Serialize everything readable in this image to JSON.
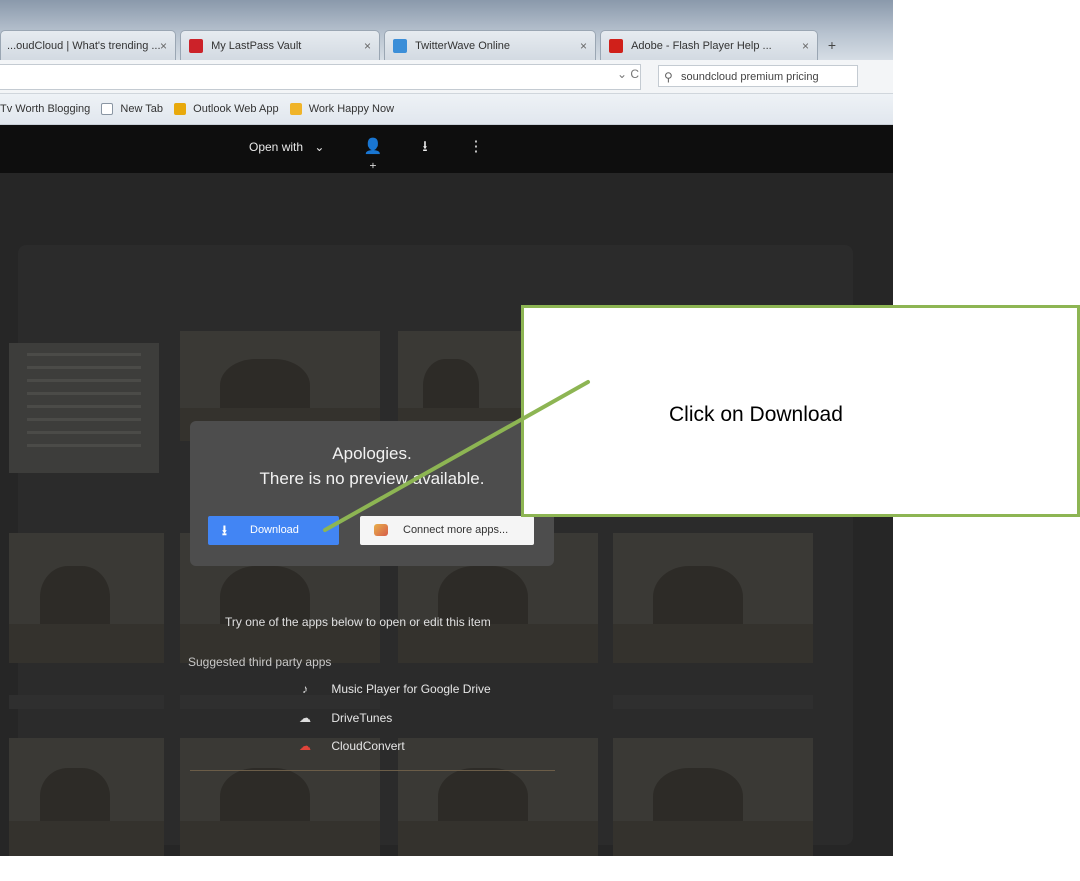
{
  "browser": {
    "tabs": [
      {
        "label": "...oudCloud | What's trending ...",
        "icon_color": "#ff7700"
      },
      {
        "label": "My LastPass Vault",
        "icon_color": "#cc2229"
      },
      {
        "label": "TwitterWave Online",
        "icon_color": "#3b8ed8"
      },
      {
        "label": "Adobe - Flash Player Help ...",
        "icon_color": "#d0201a"
      }
    ],
    "tab_close_glyph": "×",
    "new_tab_glyph": "+",
    "url_controls": "⌄ C",
    "search_value": "soundcloud premium pricing",
    "bookmarks": [
      {
        "label": "Tv Worth Blogging",
        "icon_color": ""
      },
      {
        "label": "New Tab",
        "icon_color": "#ffffff"
      },
      {
        "label": "Outlook Web App",
        "icon_color": "#e8a90c"
      },
      {
        "label": "Work Happy Now",
        "icon_color": "#f0b429"
      }
    ]
  },
  "viewer": {
    "open_with_label": "Open with",
    "toolbar_icons": [
      "add-person-icon",
      "download-icon",
      "more-vert-icon"
    ]
  },
  "dialog": {
    "title": "Apologies.",
    "message": "There is no preview available.",
    "download_label": "Download",
    "connect_label": "Connect more apps..."
  },
  "apps": {
    "prompt": "Try one of the apps below to open or edit this item",
    "suggested_label": "Suggested third party apps",
    "items": [
      {
        "label": "Music Player for Google Drive",
        "icon": "music-player-icon",
        "glyph": "♪"
      },
      {
        "label": "DriveTunes",
        "icon": "drivetunes-icon",
        "glyph": "☁"
      },
      {
        "label": "CloudConvert",
        "icon": "cloudconvert-icon",
        "glyph": "☁"
      }
    ]
  },
  "callout": {
    "text": "Click on Download",
    "border_color": "#8db553"
  }
}
